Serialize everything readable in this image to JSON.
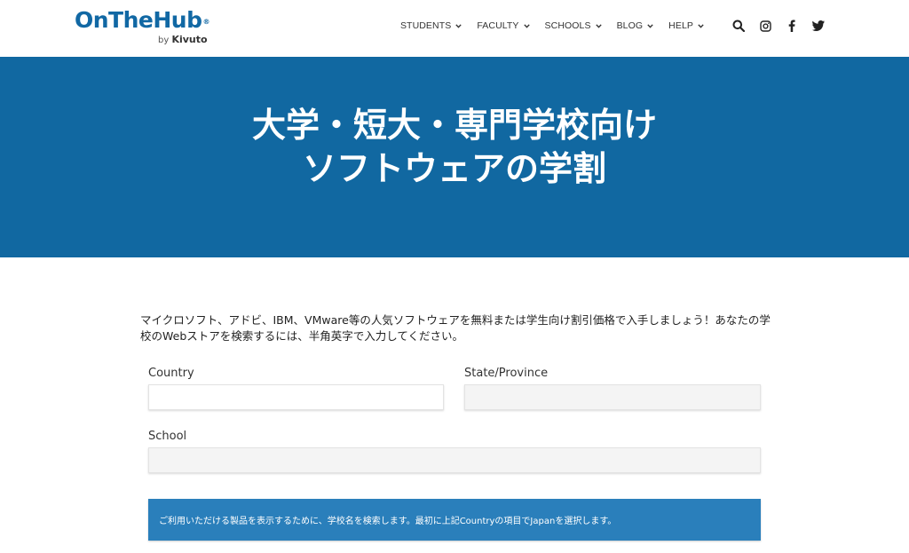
{
  "logo": {
    "name": "OnTheHub",
    "reg": "®",
    "by": "by",
    "brand": "Kivuto"
  },
  "nav": {
    "items": [
      {
        "label": "STUDENTS"
      },
      {
        "label": "FACULTY"
      },
      {
        "label": "SCHOOLS"
      },
      {
        "label": "BLOG"
      },
      {
        "label": "HELP"
      }
    ],
    "icons": [
      "search-icon",
      "instagram-icon",
      "facebook-icon",
      "twitter-icon"
    ]
  },
  "hero": {
    "line1": "大学・短大・専門学校向け",
    "line2": "ソフトウェアの学割"
  },
  "intro": "マイクロソフト、アドビ、IBM、VMware等の人気ソフトウェアを無料または学生向け割引価格で入手しましょう！あなたの学校のWebストアを検索するには、半角英字で入力してください。",
  "form": {
    "country_label": "Country",
    "country_value": "",
    "state_label": "State/Province",
    "state_value": "",
    "school_label": "School",
    "school_value": ""
  },
  "notice": "ご利用いただける製品を表示するために、学校名を検索します。最初に上記Countryの項目でJapanを選択します。",
  "colors": {
    "brand": "#1168a4",
    "hero": "#1168a1",
    "notice": "#2a7fbb"
  }
}
